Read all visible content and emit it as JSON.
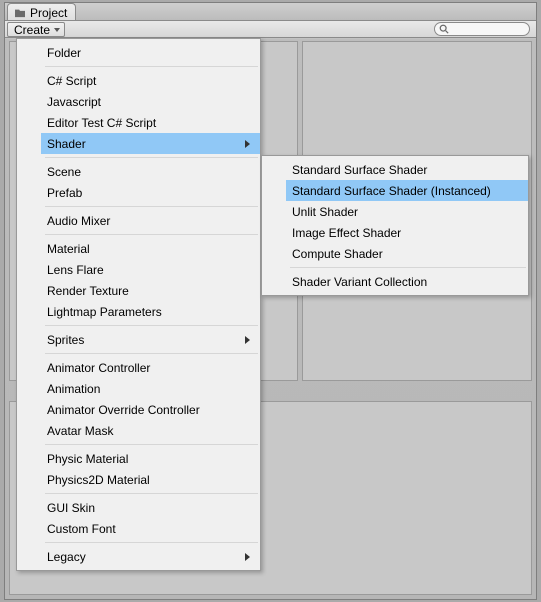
{
  "tab": {
    "title": "Project"
  },
  "toolbar": {
    "create_label": "Create",
    "search_placeholder": ""
  },
  "main_menu": {
    "groups": [
      [
        "Folder"
      ],
      [
        "C# Script",
        "Javascript",
        "Editor Test C# Script",
        "Shader"
      ],
      [
        "Scene",
        "Prefab"
      ],
      [
        "Audio Mixer"
      ],
      [
        "Material",
        "Lens Flare",
        "Render Texture",
        "Lightmap Parameters"
      ],
      [
        "Sprites"
      ],
      [
        "Animator Controller",
        "Animation",
        "Animator Override Controller",
        "Avatar Mask"
      ],
      [
        "Physic Material",
        "Physics2D Material"
      ],
      [
        "GUI Skin",
        "Custom Font"
      ],
      [
        "Legacy"
      ]
    ],
    "submenu_items": [
      "Shader",
      "Sprites",
      "Legacy"
    ],
    "highlighted": "Shader"
  },
  "sub_menu": {
    "groups": [
      [
        "Standard Surface Shader",
        "Standard Surface Shader (Instanced)",
        "Unlit Shader",
        "Image Effect Shader",
        "Compute Shader"
      ],
      [
        "Shader Variant Collection"
      ]
    ],
    "highlighted": "Standard Surface Shader (Instanced)"
  }
}
